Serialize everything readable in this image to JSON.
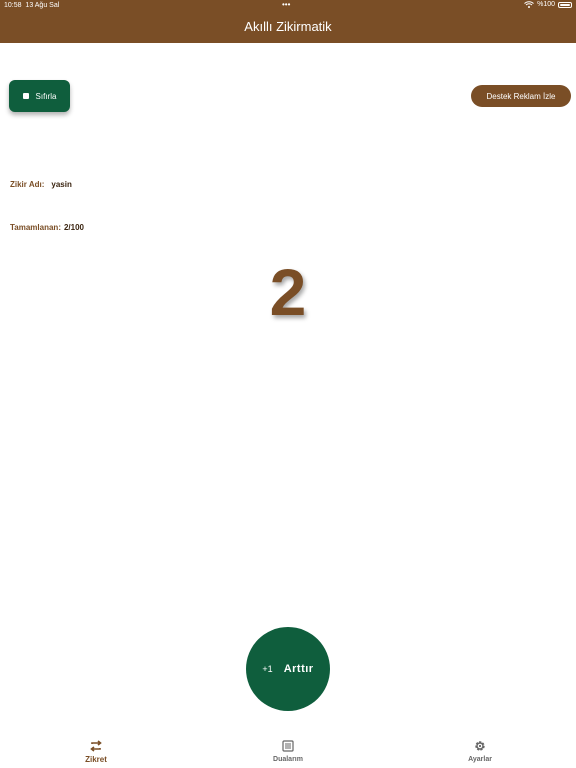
{
  "status_bar": {
    "time": "10:58",
    "date": "13 Ağu Sal",
    "dots": "•••",
    "battery": "%100"
  },
  "header": {
    "title": "Akıllı Zikirmatik"
  },
  "controls": {
    "reset_label": "Sıfırla",
    "ad_label": "Destek Reklam İzle"
  },
  "zikir": {
    "name_label": "Zikir Adı:",
    "name_value": "yasin",
    "done_label": "Tamamlanan:",
    "done_value": "2/100",
    "count": "2"
  },
  "increment": {
    "prefix": "+1",
    "label": "Arttır"
  },
  "tabs": [
    {
      "label": "Zikret",
      "icon": "repeat-icon",
      "active": true
    },
    {
      "label": "Dualarım",
      "icon": "list-icon",
      "active": false
    },
    {
      "label": "Ayarlar",
      "icon": "gear-icon",
      "active": false
    }
  ],
  "colors": {
    "brown": "#7a4e26",
    "green": "#0f5e3d",
    "background": "#ffffff"
  }
}
